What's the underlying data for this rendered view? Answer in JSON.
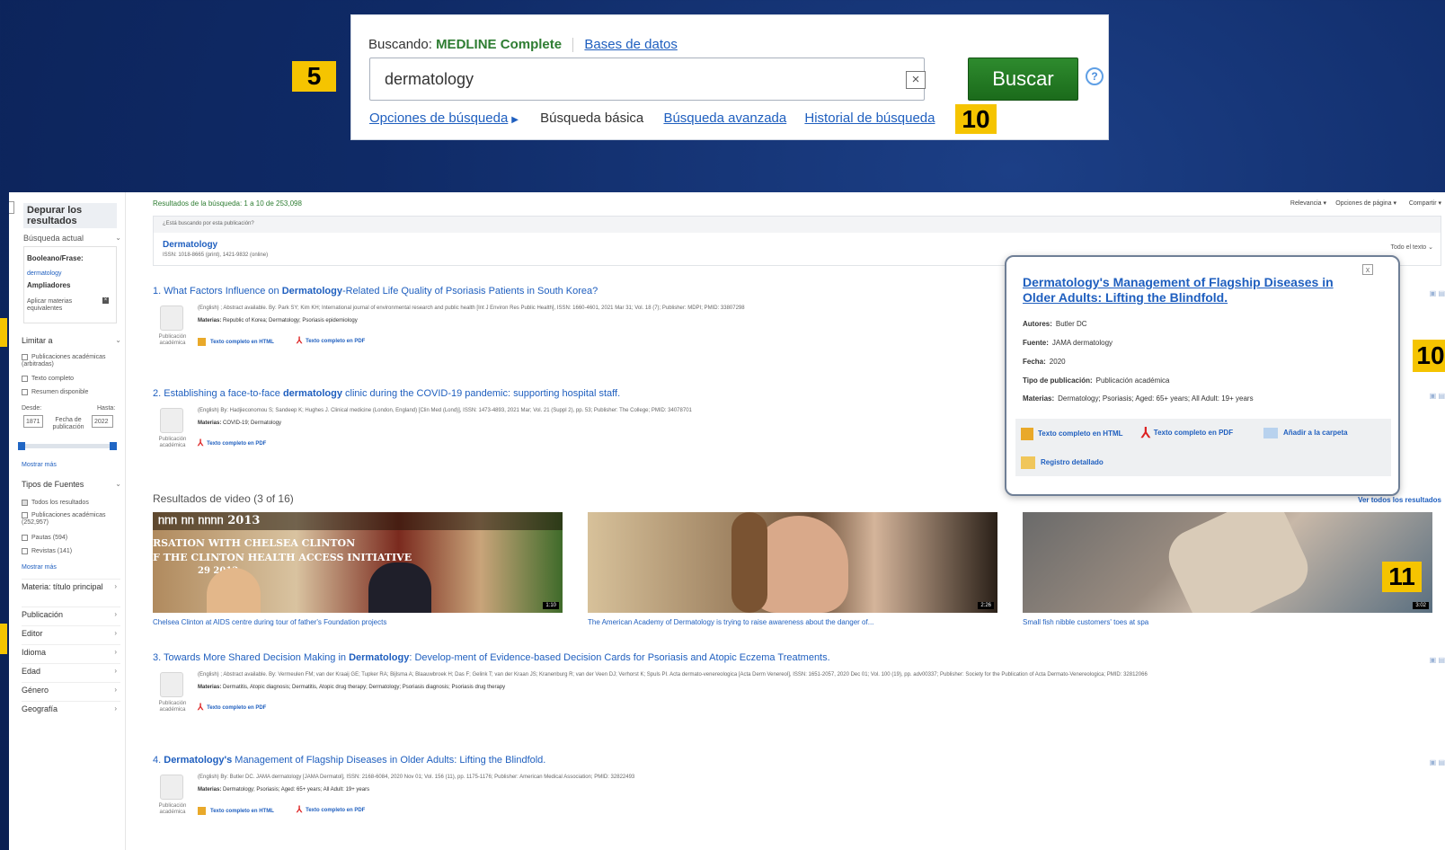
{
  "search": {
    "searching_label": "Buscando:",
    "database": "MEDLINE Complete",
    "databases_link": "Bases de datos",
    "query": "dermatology",
    "search_button": "Buscar",
    "help": "?",
    "clear": "×",
    "links": {
      "options": "Opciones de búsqueda",
      "basic": "Búsqueda básica",
      "advanced": "Búsqueda avanzada",
      "history": "Historial de búsqueda"
    }
  },
  "callouts": {
    "c5": "5",
    "c10a": "10",
    "c10b": "10",
    "c11": "11"
  },
  "sidebar": {
    "title": "Depurar los resultados",
    "current_search": "Búsqueda actual",
    "boolean_label": "Booleano/Frase:",
    "boolean_value": "dermatology",
    "expanders": "Ampliadores",
    "equivalent": "Aplicar materias equivalentes",
    "limit_to": "Limitar a",
    "limits": [
      "Publicaciones académicas (arbitradas)",
      "Texto completo",
      "Resumen disponible"
    ],
    "from_label": "Desde:",
    "to_label": "Hasta:",
    "from_value": "1871",
    "to_value": "2022",
    "pub_date": "Fecha de publicación",
    "show_more": "Mostrar más",
    "source_types": "Tipos de Fuentes",
    "source_items": [
      "Todos los resultados",
      "Publicaciones académicas (252,957)",
      "Pautas (594)",
      "Revistas (141)"
    ],
    "show_more2": "Mostrar más",
    "facets": [
      "Materia: título principal",
      "Publicación",
      "Editor",
      "Idioma",
      "Edad",
      "Género",
      "Geografía"
    ]
  },
  "results": {
    "count_text": "Resultados de la búsqueda: 1 a 10 de 253,098",
    "sort": "Relevancia ▾",
    "page_options": "Opciones de página ▾",
    "share": "Compartir ▾",
    "pub_question": "¿Está buscando por esta publicación?",
    "pub_name": "Dermatology",
    "pub_issn": "ISSN: 1018-8665 (print), 1421-9832 (online)",
    "pub_collapsed": "Todo el texto ⌄",
    "items": [
      {
        "num": "1.",
        "pre": "What Factors Influence on ",
        "bold": "Dermatology",
        "post": "-Related Life Quality of Psoriasis Patients in South Korea?",
        "meta": "(English) ; Abstract available. By: Park SY; Kim KH; International journal of environmental research and public health [Int J Environ Res Public Health], ISSN: 1660-4601, 2021 Mar 31; Vol. 18 (7); Publisher: MDPI; PMID: 33807298",
        "subjects_label": "Materias:",
        "subjects": "Republic of Korea; Dermatology; Psoriasis epidemiology",
        "doc_type": "Publicación académica",
        "html": "Texto completo en HTML",
        "pdf": "Texto completo en PDF"
      },
      {
        "num": "2.",
        "pre": "Establishing a face-to-face ",
        "bold": "dermatology",
        "post": " clinic during the COVID-19 pandemic: supporting hospital staff.",
        "meta": "(English) By: Hadjieconomou S; Sandeep K; Hughes J. Clinical medicine (London, England) [Clin Med (Lond)], ISSN: 1473-4893, 2021 Mar; Vol. 21 (Suppl 2), pp. 53; Publisher: The College; PMID: 34078701",
        "subjects_label": "Materias:",
        "subjects": "COVID-19; Dermatology",
        "doc_type": "Publicación académica",
        "pdf": "Texto completo en PDF"
      },
      {
        "num": "3.",
        "pre": "Towards More Shared Decision Making in ",
        "bold": "Dermatology",
        "post": ": Develop-ment of Evidence-based Decision Cards for Psoriasis and Atopic Eczema Treatments.",
        "meta": "(English) ; Abstract available. By: Vermeulen FM; van der Kraaij GE; Tupker RA; Bijlsma A; Blaauwbroek H; Das F; Gelink T; van der Kraan JS; Kranenburg R; van der Veen DJ; Verhorst K; Spuls PI. Acta dermato-venereologica [Acta Derm Venereol], ISSN: 1651-2057, 2020 Dec 01; Vol. 100 (19), pp. adv00337; Publisher: Society for the Publication of Acta Dermato-Venereologica; PMID: 32812066",
        "subjects_label": "Materias:",
        "subjects": "Dermatitis, Atopic diagnosis; Dermatitis, Atopic drug therapy; Dermatology; Psoriasis diagnosis; Psoriasis drug therapy",
        "doc_type": "Publicación académica",
        "pdf": "Texto completo en PDF"
      },
      {
        "num": "4.",
        "pre": "",
        "bold": "Dermatology's",
        "post": " Management of Flagship Diseases in Older Adults: Lifting the Blindfold.",
        "meta": "(English) By: Butler DC. JAMA dermatology [JAMA Dermatol], ISSN: 2168-6084, 2020 Nov 01; Vol. 156 (11), pp. 1175-1176; Publisher: American Medical Association; PMID: 32822493",
        "subjects_label": "Materias:",
        "subjects": "Dermatology; Psoriasis; Aged: 65+ years; All Adult: 19+ years",
        "doc_type": "Publicación académica",
        "html": "Texto completo en HTML",
        "pdf": "Texto completo en PDF"
      }
    ],
    "video_heading": "Resultados de video (3 of 16)",
    "see_all": "Ver todos los resultados",
    "videos": [
      {
        "caption": "Chelsea Clinton at AIDS centre during tour of father's Foundation projects",
        "duration": "1:10",
        "overlay1": "ᥒᥒᥒ ᥒᥒ ᥒᥒᥒᥒ 2013",
        "overlay2": "RSATION WITH CHELSEA CLINTON",
        "overlay3": "F THE CLINTON HEALTH ACCESS INITIATIVE",
        "overlay4": "29        2013"
      },
      {
        "caption": "The American Academy of Dermatology is trying to raise awareness about the danger of...",
        "duration": "2:26"
      },
      {
        "caption": "Small fish nibble customers' toes at spa",
        "duration": "3:02"
      }
    ]
  },
  "popover": {
    "title": "Dermatology's Management of Flagship Diseases in Older Adults: Lifting the Blindfold.",
    "authors_label": "Autores:",
    "authors": "Butler DC",
    "source_label": "Fuente:",
    "source": "JAMA dermatology",
    "date_label": "Fecha:",
    "date": "2020",
    "pubtype_label": "Tipo de publicación:",
    "pubtype": "Publicación académica",
    "subjects_label": "Materias:",
    "subjects": "Dermatology; Psoriasis; Aged: 65+ years; All Adult: 19+ years",
    "html": "Texto completo en HTML",
    "pdf": "Texto completo en PDF",
    "folder": "Añadir a la carpeta",
    "detail": "Registro detallado",
    "close": "x"
  }
}
